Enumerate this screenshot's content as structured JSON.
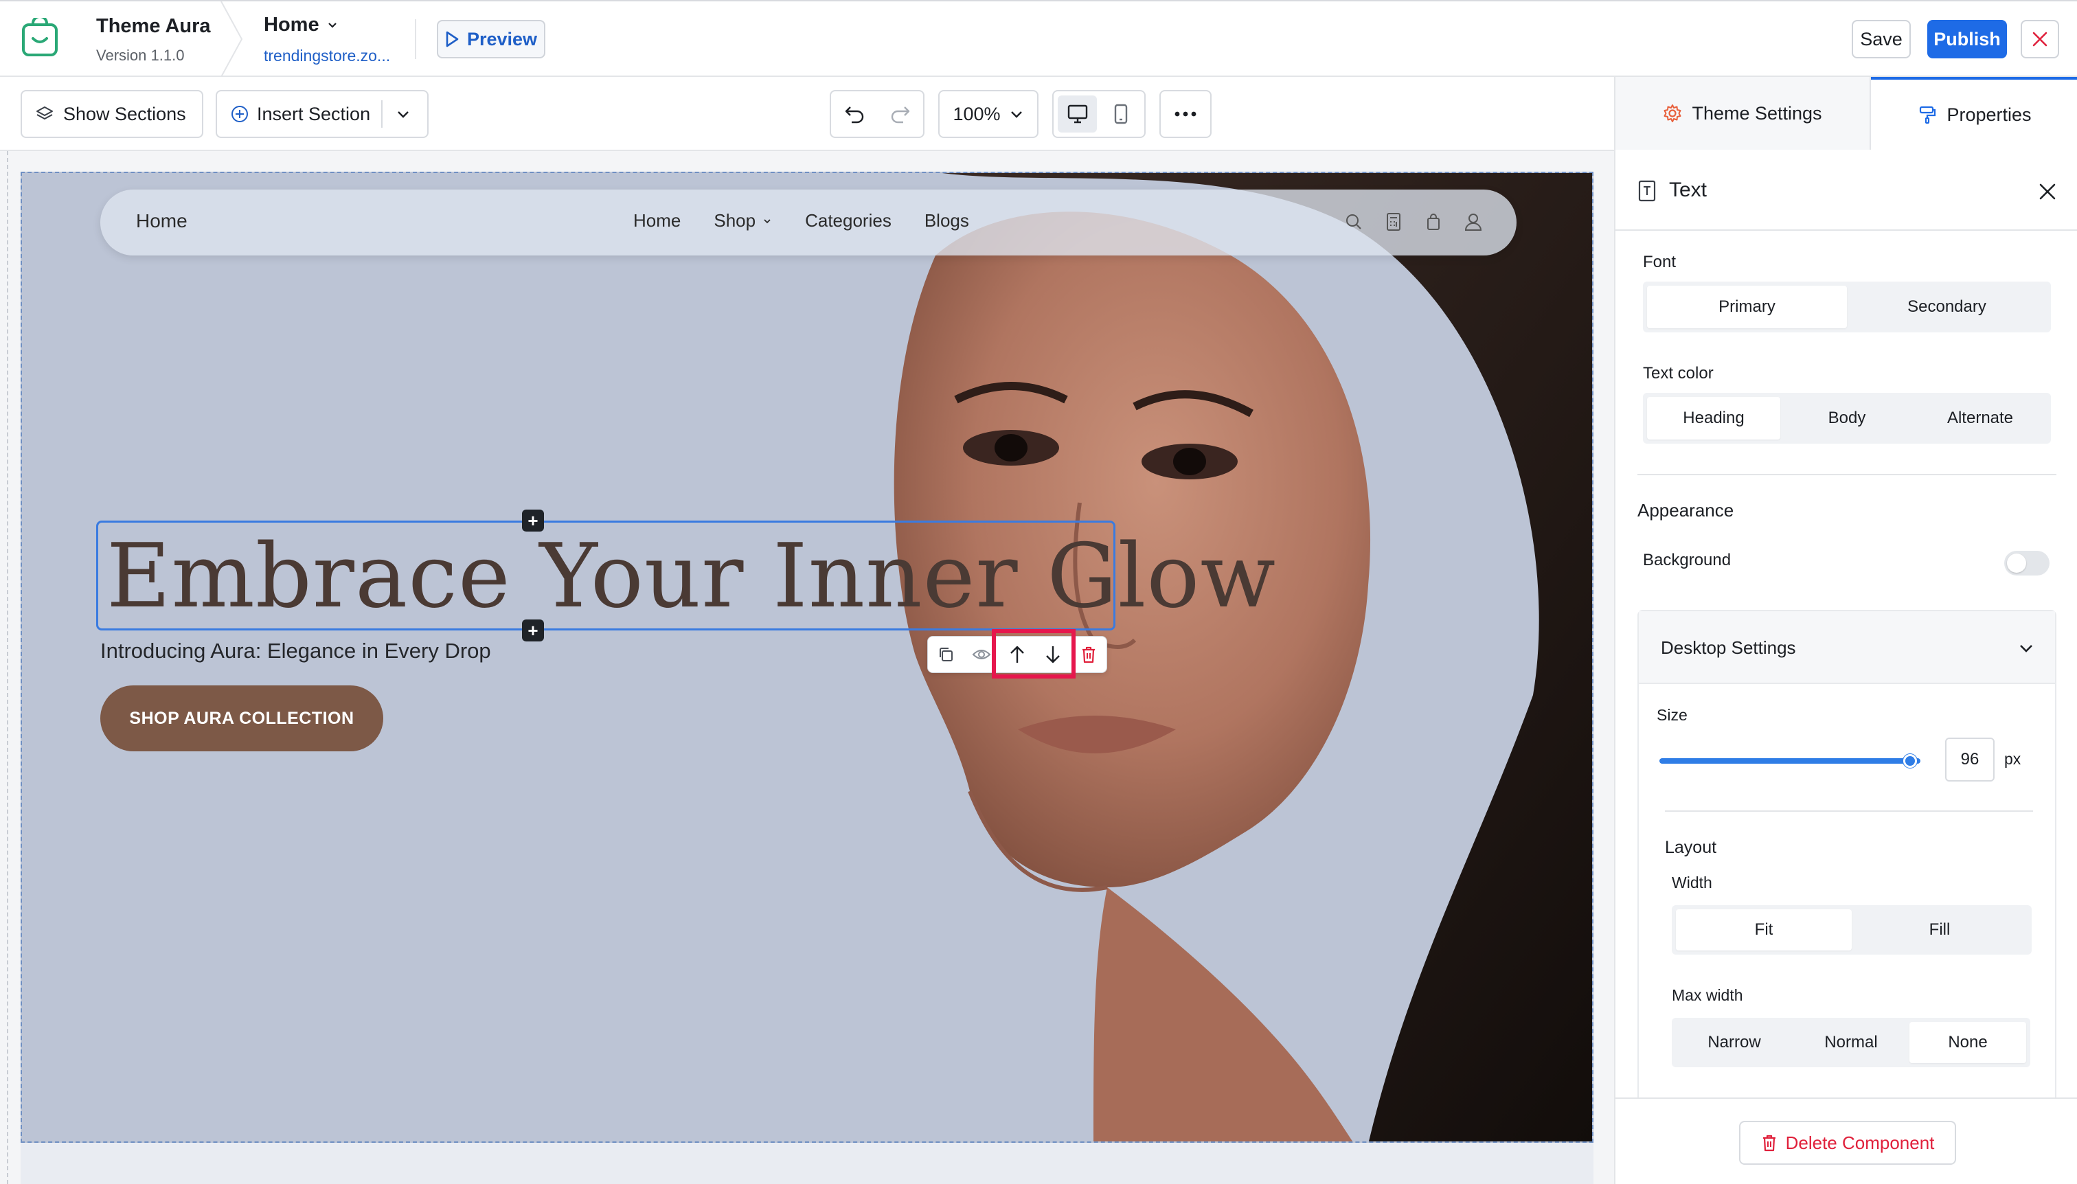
{
  "topbar": {
    "theme_name": "Theme Aura",
    "version": "Version 1.1.0",
    "page": "Home",
    "store_link": "trendingstore.zo...",
    "preview_label": "Preview",
    "save_label": "Save",
    "publish_label": "Publish",
    "accent": "#1e6be6"
  },
  "toolbar": {
    "show_sections": "Show Sections",
    "insert_section": "Insert Section",
    "zoom": "100%"
  },
  "hero": {
    "nav_brand": "Home",
    "nav_links": [
      "Home",
      "Shop",
      "Categories",
      "Blogs"
    ],
    "headline": "Embrace Your Inner Glow",
    "subheadline": "Introducing Aura: Elegance in Every Drop",
    "cta": "SHOP AURA COLLECTION",
    "cta_color": "#7d5947",
    "background_color": "#bcc4d5"
  },
  "panel": {
    "tab_theme_settings": "Theme Settings",
    "tab_properties": "Properties",
    "title": "Text",
    "font_label": "Font",
    "font_options": [
      "Primary",
      "Secondary"
    ],
    "text_color_label": "Text color",
    "text_color_options": [
      "Heading",
      "Body",
      "Alternate"
    ],
    "appearance_label": "Appearance",
    "background_label": "Background",
    "desktop_settings": "Desktop Settings",
    "size_label": "Size",
    "size_value": "96",
    "size_unit": "px",
    "size_slider_fraction": 0.96,
    "layout_label": "Layout",
    "width_label": "Width",
    "width_options": [
      "Fit",
      "Fill"
    ],
    "max_width_label": "Max width",
    "max_width_options": [
      "Narrow",
      "Normal",
      "None"
    ],
    "delete_label": "Delete Component",
    "delete_color": "#e0203b"
  }
}
